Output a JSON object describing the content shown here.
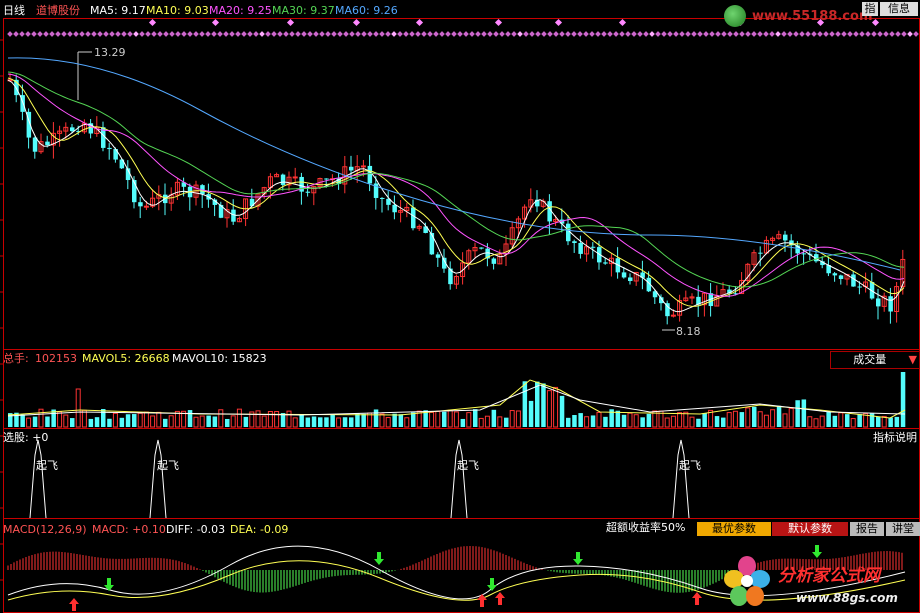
{
  "colors": {
    "background": "#000000",
    "up": "#ff3333",
    "down": "#54fcfc",
    "ma5": "#ffffff",
    "ma10": "#ffff54",
    "ma20": "#ff54ff",
    "ma30": "#54d454",
    "ma60": "#54a8ff",
    "frame": "#c80000"
  },
  "header": {
    "period": "日线",
    "stock_name": "道博股份",
    "ma5": "MA5: 9.17",
    "ma10": "MA10: 9.03",
    "ma20": "MA20: 9.25",
    "ma30": "MA30: 9.37",
    "ma60": "MA60: 9.26"
  },
  "watermark_top": "www.55188.com",
  "top_right_buttons": [
    "指",
    "信息"
  ],
  "price_panel": {
    "high_label": "13.29",
    "low_label": "8.18"
  },
  "volume_panel": {
    "total_label": "总手:",
    "total_value": "102153",
    "mavol5": "MAVOL5: 26668",
    "mavol10": "MAVOL10: 15823",
    "indicator_name": "成交量"
  },
  "select_panel": {
    "label": "选股: +0",
    "help": "指标说明",
    "signal_text": "起飞"
  },
  "macd_panel": {
    "title": "MACD(12,26,9)",
    "macd": "MACD: +0.10",
    "diff": "DIFF: -0.03",
    "dea": "DEA: -0.09",
    "excess_return": "超额收益率50%",
    "btn_best": "最优参数",
    "btn_default": "默认参数",
    "btn_report": "报告",
    "btn_lecture": "讲堂"
  },
  "footer_logo": {
    "name": "分析家公式网",
    "url": "www.88gs.com"
  }
}
